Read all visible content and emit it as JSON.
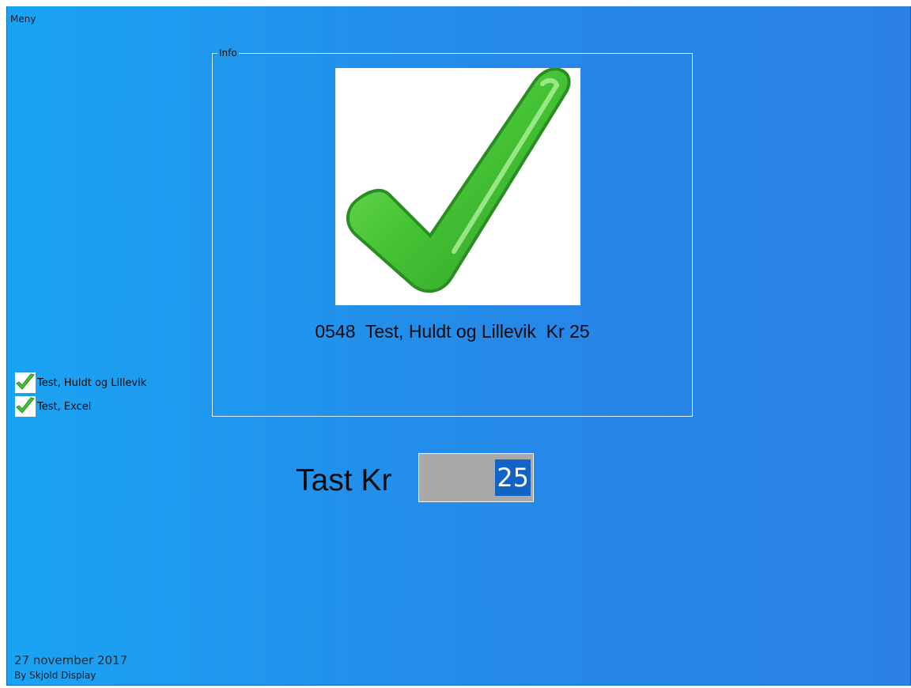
{
  "menu": {
    "label": "Meny"
  },
  "info": {
    "legend": "Info",
    "status_icon": "large-green-checkmark",
    "result": "0548  Test, Huldt og Lillevik  Kr 25"
  },
  "list": {
    "items": [
      {
        "label": "Test, Huldt og Lillevik",
        "icon": "green-checkmark"
      },
      {
        "label": "Test, Excel",
        "icon": "green-checkmark"
      }
    ]
  },
  "amount": {
    "label": "Tast Kr",
    "value": "25"
  },
  "footer": {
    "date": "27 november 2017",
    "by": "By Skjold Display"
  },
  "colors": {
    "background_left": "#1aa3f3",
    "background_right": "#2b80e6",
    "check_green": "#4cc23a",
    "selection_blue": "#1264c4",
    "input_gray": "#a9a9a9"
  }
}
